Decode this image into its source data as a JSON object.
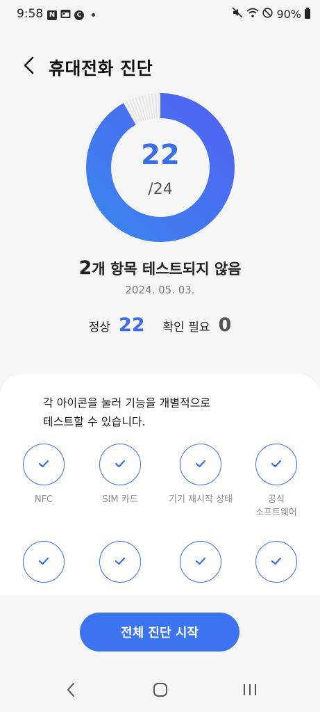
{
  "status_bar": {
    "time": "9:58",
    "notif_n": "N",
    "notif_c": "C",
    "battery": "90%"
  },
  "header": {
    "title": "휴대전화 진단"
  },
  "result": {
    "passed": "22",
    "total": "/24",
    "passed_fraction": 0.9167,
    "not_tested_count": "2",
    "not_tested_text": "개 항목 테스트되지 않음",
    "date": "2024. 05. 03."
  },
  "summary": {
    "normal_label": "정상",
    "normal_value": "22",
    "check_label": "확인 필요",
    "check_value": "0"
  },
  "card": {
    "description": "각 아이콘을 눌러 기능을 개별적으로\n테스트할 수 있습니다.",
    "tests": [
      {
        "label": "NFC"
      },
      {
        "label": "SIM 카드"
      },
      {
        "label": "기기 재시작 상태"
      },
      {
        "label": "공식\n소프트웨어"
      },
      {
        "label": ""
      },
      {
        "label": ""
      },
      {
        "label": ""
      },
      {
        "label": ""
      }
    ]
  },
  "actions": {
    "start_label": "전체 진단 시작"
  },
  "colors": {
    "accent": "#3a6ee8",
    "ring_end": "#4f66f2",
    "ring_rest": "#e4e4e4"
  }
}
